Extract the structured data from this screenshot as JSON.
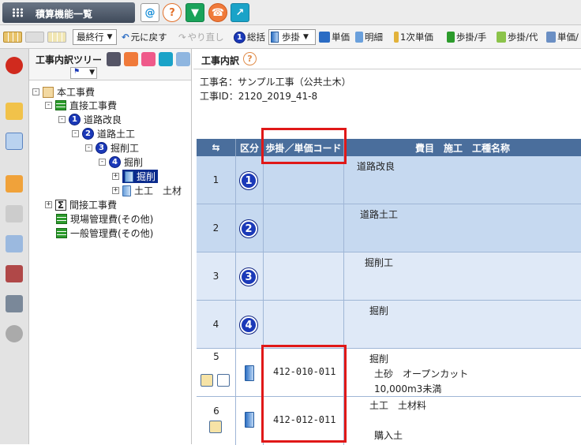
{
  "topbar": {
    "menu_label": "積算機能一覧"
  },
  "toolbar": {
    "last_row": "最終行",
    "undo": "元に戻す",
    "redo": "やり直し",
    "summary": "総括",
    "step_select": "歩掛",
    "unit_price": "単価",
    "detail": "明細",
    "first_unit_price": "1次単価",
    "step_hand": "歩掛/手",
    "step_proxy": "歩掛/代",
    "unit_price_2": "単価/"
  },
  "tree": {
    "title": "工事内訳ツリー",
    "nodes": [
      {
        "label": "本工事費"
      },
      {
        "label": "直接工事費"
      },
      {
        "num": "1",
        "label": "道路改良"
      },
      {
        "num": "2",
        "label": "道路土工"
      },
      {
        "num": "3",
        "label": "掘削工"
      },
      {
        "num": "4",
        "label": "掘削"
      },
      {
        "label": "掘削"
      },
      {
        "label": "土工　土材"
      },
      {
        "label": "間接工事費"
      },
      {
        "label": "現場管理費(その他)"
      },
      {
        "label": "一般管理費(その他)"
      }
    ]
  },
  "main": {
    "title": "工事内訳",
    "project_name": "工事名：サンプル工事（公共土木）",
    "project_id": "工事ID：2120_2019_41-8",
    "columns": {
      "kubun": "区分",
      "code": "歩掛／単価コード",
      "item": "費目　施工　工種名称"
    },
    "rows": [
      {
        "no": "1",
        "num": "1",
        "code": "",
        "lines": [
          "道路改良"
        ]
      },
      {
        "no": "2",
        "num": "2",
        "code": "",
        "lines": [
          "道路土工"
        ]
      },
      {
        "no": "3",
        "num": "3",
        "code": "",
        "lines": [
          "掘削工"
        ]
      },
      {
        "no": "4",
        "num": "4",
        "code": "",
        "lines": [
          "掘削"
        ]
      },
      {
        "no": "5",
        "num": "",
        "code": "412-010-011",
        "lines": [
          "掘削",
          "土砂　オープンカット",
          "10,000m3未満"
        ]
      },
      {
        "no": "6",
        "num": "",
        "code": "412-012-011",
        "lines": [
          "土工　土材料",
          "",
          "購入土"
        ]
      }
    ]
  },
  "colors": {
    "header_blue": "#4a6e9c",
    "row_blue": "#c6d9f0",
    "row_light": "#dfe9f7",
    "highlight": "#e01818"
  }
}
